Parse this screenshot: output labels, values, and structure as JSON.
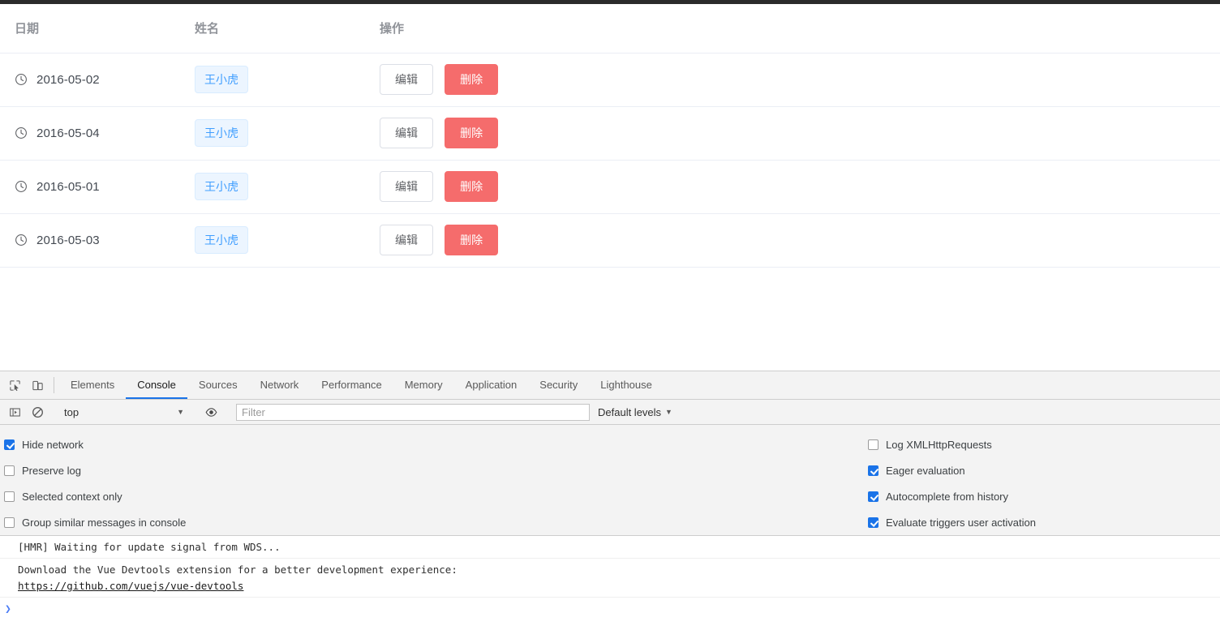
{
  "page": {
    "table": {
      "columns": [
        {
          "key": "date",
          "label": "日期"
        },
        {
          "key": "name",
          "label": "姓名"
        },
        {
          "key": "ops",
          "label": "操作"
        }
      ],
      "rows": [
        {
          "date": "2016-05-02",
          "name": "王小虎",
          "edit": "编辑",
          "delete": "删除",
          "icon": "clock-icon"
        },
        {
          "date": "2016-05-04",
          "name": "王小虎",
          "edit": "编辑",
          "delete": "删除",
          "icon": "clock-icon"
        },
        {
          "date": "2016-05-01",
          "name": "王小虎",
          "edit": "编辑",
          "delete": "删除",
          "icon": "clock-icon"
        },
        {
          "date": "2016-05-03",
          "name": "王小虎",
          "edit": "编辑",
          "delete": "删除",
          "icon": "clock-icon"
        }
      ],
      "colors": {
        "header_text": "#909399",
        "row_border": "#ebeef5",
        "tag_bg": "#ecf5ff",
        "tag_border": "#d9ecff",
        "tag_text": "#409eff",
        "danger_bg": "#f56c6c",
        "default_border": "#dcdfe6"
      }
    }
  },
  "devtools": {
    "tabbar": {
      "icons": [
        {
          "name": "inspect-element-icon"
        },
        {
          "name": "device-toolbar-icon"
        }
      ],
      "tabs": [
        {
          "label": "Elements",
          "active": false
        },
        {
          "label": "Console",
          "active": true
        },
        {
          "label": "Sources",
          "active": false
        },
        {
          "label": "Network",
          "active": false
        },
        {
          "label": "Performance",
          "active": false
        },
        {
          "label": "Memory",
          "active": false
        },
        {
          "label": "Application",
          "active": false
        },
        {
          "label": "Security",
          "active": false
        },
        {
          "label": "Lighthouse",
          "active": false
        }
      ],
      "active_tab_underline": "#1a73e8"
    },
    "toolbar": {
      "sidebar_toggle_icon": "console-sidebar-icon",
      "clear_console_icon": "clear-console-icon",
      "context_selected": "top",
      "context_caret": "▼",
      "live_expression_icon": "eye-icon",
      "filter_value": "",
      "filter_placeholder": "Filter",
      "levels_label": "Default levels",
      "levels_caret": "▼"
    },
    "settings": {
      "left": [
        {
          "label": "Hide network",
          "checked": true
        },
        {
          "label": "Preserve log",
          "checked": false
        },
        {
          "label": "Selected context only",
          "checked": false
        },
        {
          "label": "Group similar messages in console",
          "checked": false
        }
      ],
      "right": [
        {
          "label": "Log XMLHttpRequests",
          "checked": false
        },
        {
          "label": "Eager evaluation",
          "checked": true
        },
        {
          "label": "Autocomplete from history",
          "checked": true
        },
        {
          "label": "Evaluate triggers user activation",
          "checked": true
        }
      ],
      "checked_color": "#1a73e8"
    },
    "console": {
      "messages": [
        {
          "text": "[HMR] Waiting for update signal from WDS...",
          "link": ""
        },
        {
          "text": "Download the Vue Devtools extension for a better development experience:",
          "link": "https://github.com/vuejs/vue-devtools"
        }
      ],
      "prompt_caret": "❯",
      "prompt_value": ""
    }
  }
}
